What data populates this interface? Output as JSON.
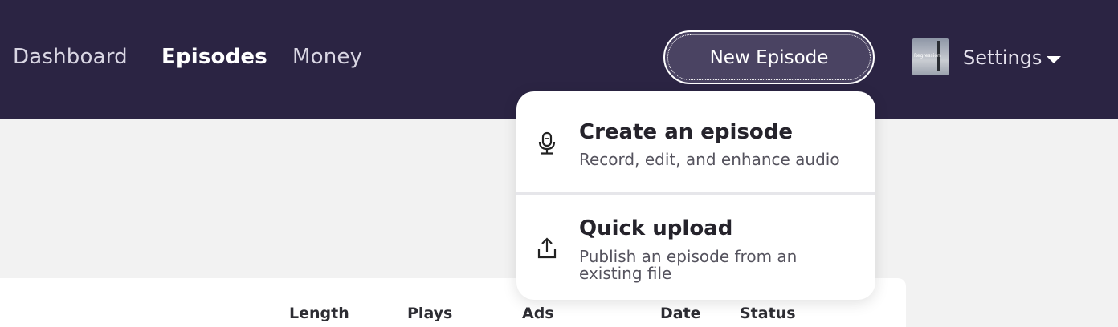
{
  "nav": {
    "dashboard": "Dashboard",
    "episodes": "Episodes",
    "money": "Money"
  },
  "header": {
    "new_episode_label": "New Episode",
    "settings_label": "Settings",
    "avatar_text": "Regression"
  },
  "dropdown": {
    "items": [
      {
        "icon": "microphone-icon",
        "title": "Create an episode",
        "description": "Record, edit, and enhance audio"
      },
      {
        "icon": "upload-icon",
        "title": "Quick upload",
        "description": "Publish an episode from an existing file"
      }
    ]
  },
  "table": {
    "columns": [
      "Length",
      "Plays",
      "Ads",
      "Date",
      "Status"
    ]
  },
  "colors": {
    "topbar": "#2b2443",
    "button": "#4a4362",
    "page_bg": "#f2f2f2"
  }
}
